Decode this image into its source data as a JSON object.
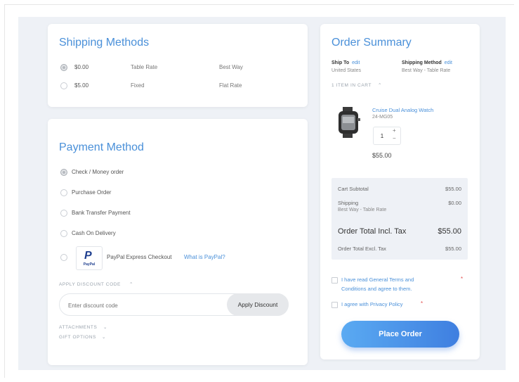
{
  "shipping": {
    "title": "Shipping Methods",
    "methods": [
      {
        "price": "$0.00",
        "method": "Table Rate",
        "carrier": "Best Way",
        "selected": true
      },
      {
        "price": "$5.00",
        "method": "Fixed",
        "carrier": "Flat Rate",
        "selected": false
      }
    ]
  },
  "payment": {
    "title": "Payment Method",
    "options": [
      {
        "label": "Check / Money order",
        "selected": true
      },
      {
        "label": "Purchase Order",
        "selected": false
      },
      {
        "label": "Bank Transfer Payment",
        "selected": false
      },
      {
        "label": "Cash On Delivery",
        "selected": false
      }
    ],
    "paypal": {
      "logo_text": "PayPal",
      "label": "PayPal Express Checkout",
      "link": "What is PayPal?"
    },
    "discount": {
      "toggle_label": "APPLY DISCOUNT CODE",
      "placeholder": "Enter discount code",
      "button": "Apply Discount"
    },
    "attachments_label": "ATTACHMENTS",
    "gift_label": "GIFT OPTIONS"
  },
  "summary": {
    "title": "Order Summary",
    "ship_to_label": "Ship To",
    "ship_to_edit": "edit",
    "ship_to_value": "United States",
    "shipping_method_label": "Shipping Method",
    "shipping_method_edit": "edit",
    "shipping_method_value": "Best Way - Table Rate",
    "items_label": "1 ITEM IN CART",
    "item": {
      "name": "Cruise Dual Analog Watch",
      "sku": "24-MG05",
      "qty": "1",
      "qty_plus": "+",
      "qty_minus": "−",
      "price": "$55.00"
    },
    "totals": {
      "subtotal_label": "Cart Subtotal",
      "subtotal_value": "$55.00",
      "shipping_label": "Shipping",
      "shipping_sub": "Best Way - Table Rate",
      "shipping_value": "$0.00",
      "grand_label": "Order Total Incl. Tax",
      "grand_value": "$55.00",
      "excl_label": "Order Total Excl. Tax",
      "excl_value": "$55.00"
    },
    "terms_label_line1": "I have read General Terms and",
    "terms_label_line2": "Conditions and agree to them.",
    "privacy_label": "I agree with Privacy Policy",
    "required_mark": "*",
    "place_order": "Place Order"
  },
  "colors": {
    "accent": "#4a90d9",
    "button_gradient_start": "#5aaaf2",
    "button_gradient_end": "#3f7fe0"
  }
}
